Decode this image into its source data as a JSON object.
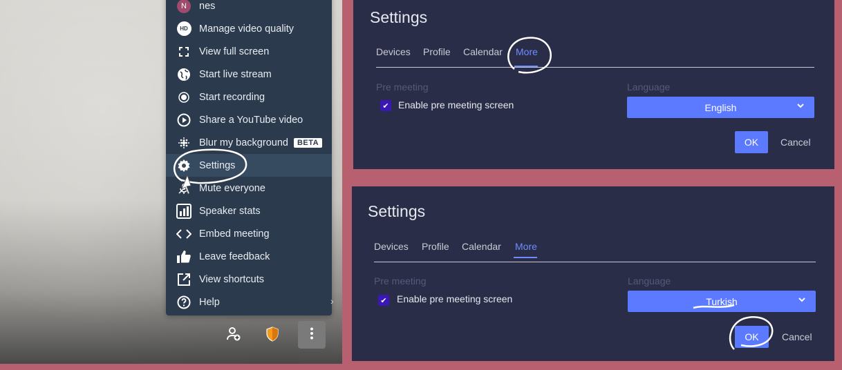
{
  "menu": {
    "items": [
      {
        "label": "nes",
        "icon": "avatar",
        "avatar_initial": "N"
      },
      {
        "label": "Manage video quality",
        "icon": "hd-icon",
        "badge_text": "HD"
      },
      {
        "label": "View full screen",
        "icon": "fullscreen-icon"
      },
      {
        "label": "Start live stream",
        "icon": "globe-icon"
      },
      {
        "label": "Start recording",
        "icon": "record-icon"
      },
      {
        "label": "Share a YouTube video",
        "icon": "play-circle-icon"
      },
      {
        "label": "Blur my background",
        "icon": "blur-icon",
        "badge": "BETA"
      },
      {
        "label": "Settings",
        "icon": "gear-icon",
        "active": true
      },
      {
        "label": "Mute everyone",
        "icon": "mic-off-icon"
      },
      {
        "label": "Speaker stats",
        "icon": "bar-chart-icon"
      },
      {
        "label": "Embed meeting",
        "icon": "code-icon"
      },
      {
        "label": "Leave feedback",
        "icon": "thumbs-up-icon"
      },
      {
        "label": "View shortcuts",
        "icon": "external-icon"
      },
      {
        "label": "Help",
        "icon": "help-icon"
      }
    ]
  },
  "toolbar": {
    "buttons": [
      {
        "name": "invite-people-icon"
      },
      {
        "name": "security-shield-icon",
        "color": "#f59a1a"
      },
      {
        "name": "more-actions-icon"
      }
    ]
  },
  "dialogs": [
    {
      "title": "Settings",
      "tabs": [
        "Devices",
        "Profile",
        "Calendar",
        "More"
      ],
      "active_tab": "More",
      "pre_meeting_label": "Pre meeting",
      "checkbox_label": "Enable pre meeting screen",
      "checkbox_checked": true,
      "language_label": "Language",
      "language_value": "English",
      "ok_label": "OK",
      "cancel_label": "Cancel"
    },
    {
      "title": "Settings",
      "tabs": [
        "Devices",
        "Profile",
        "Calendar",
        "More"
      ],
      "active_tab": "More",
      "pre_meeting_label": "Pre meeting",
      "checkbox_label": "Enable pre meeting screen",
      "checkbox_checked": true,
      "language_label": "Language",
      "language_value": "Turkish",
      "ok_label": "OK",
      "cancel_label": "Cancel"
    }
  ],
  "colors": {
    "background": "#b8606f",
    "menu_bg": "#2b3a4c",
    "dialog_bg": "#2a2d47",
    "accent": "#5c7aff",
    "active_tab": "#6f8cff",
    "checkbox": "#3b17b8"
  }
}
